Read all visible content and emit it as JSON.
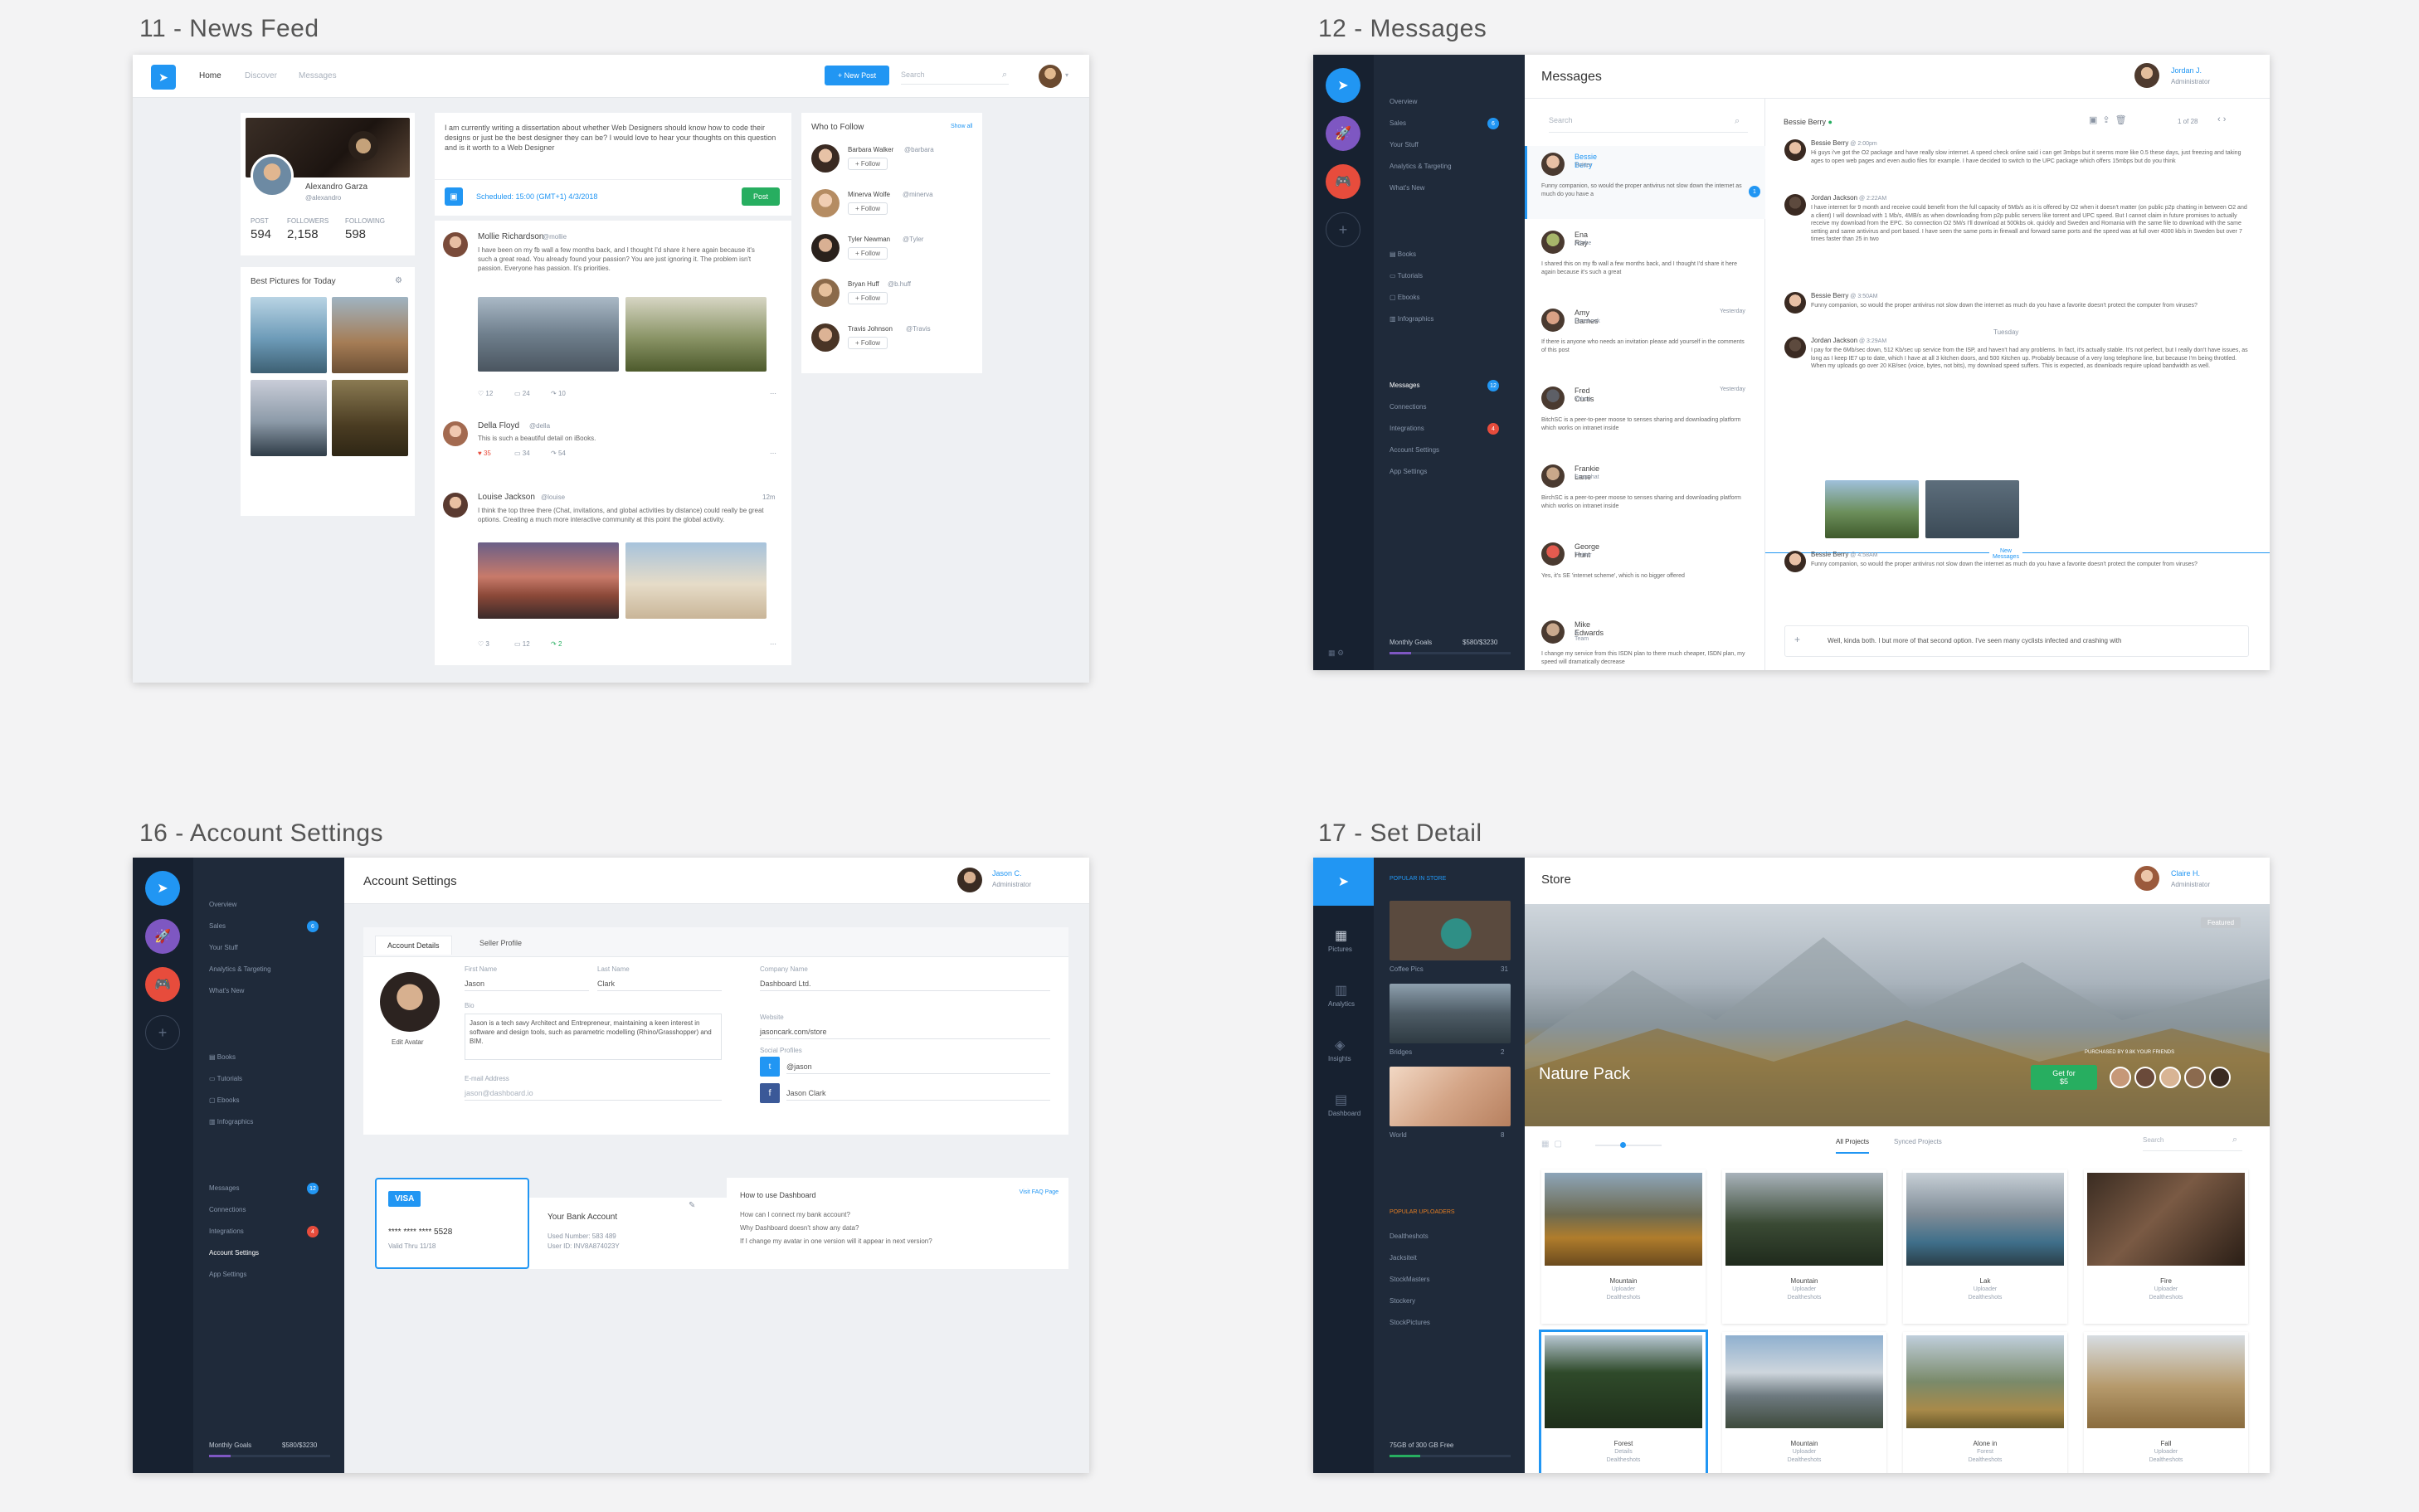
{
  "screens": {
    "news_feed": {
      "label": "11 - News Feed",
      "nav": [
        "Home",
        "Discover",
        "Messages"
      ],
      "new_post": "New Post",
      "search_placeholder": "Search",
      "profile": {
        "name": "Alexandro Garza",
        "handle": "@alexandro",
        "stats": [
          {
            "label": "POST",
            "value": "594"
          },
          {
            "label": "FOLLOWERS",
            "value": "2,158"
          },
          {
            "label": "FOLLOWING",
            "value": "598"
          }
        ]
      },
      "best_pictures_title": "Best Pictures for Today",
      "composer_text": "I am currently writing a dissertation about whether Web Designers should know how to code their designs or just be the best designer they can be? I would love to hear your thoughts on this question and is it worth to a Web Designer",
      "scheduled": "Scheduled: 15:00 (GMT+1) 4/3/2018",
      "post_button": "Post",
      "posts": [
        {
          "name": "Mollie Richardson",
          "handle": "@mollie",
          "text": "I have been on my fb wall a few months back, and I thought I'd share it here again because it's such a great read. You already found your passion? You are just ignoring it. The problem isn't passion. Everyone has passion. It's priorities.",
          "likes": "12",
          "comments": "24",
          "shares": "10"
        },
        {
          "name": "Della Floyd",
          "handle": "@della",
          "text": "This is such a beautiful detail on iBooks.",
          "likes": "35",
          "comments": "34",
          "shares": "54"
        },
        {
          "name": "Louise Jackson",
          "handle": "@louise",
          "time": "12m",
          "text": "I think the top three there (Chat, invitations, and global activities by distance) could really be great options. Creating a much more interactive community at this point the global activity.",
          "likes": "3",
          "comments": "12",
          "shares": "2"
        }
      ],
      "who_to_follow": "Who to Follow",
      "show_all": "Show all",
      "follow_label": "Follow",
      "follow": [
        {
          "name": "Barbara Walker",
          "handle": "@barbara"
        },
        {
          "name": "Minerva Wolfe",
          "handle": "@minerva"
        },
        {
          "name": "Tyler Newman",
          "handle": "@Tyler"
        },
        {
          "name": "Bryan Huff",
          "handle": "@b.huff"
        },
        {
          "name": "Travis Johnson",
          "handle": "@Travis"
        }
      ]
    },
    "messages": {
      "label": "12 - Messages",
      "title": "Messages",
      "user": {
        "name": "Jordan J.",
        "role": "Administrator"
      },
      "sidebar_top": [
        "Overview",
        "Sales",
        "Your Stuff",
        "Analytics & Targeting",
        "What's New"
      ],
      "sidebar_mid": [
        "Books",
        "Tutorials",
        "Ebooks",
        "Infographics"
      ],
      "sidebar_bottom": [
        "Messages",
        "Connections",
        "Integrations",
        "Account Settings",
        "App Settings"
      ],
      "monthly_goals": "Monthly Goals",
      "goal_value": "$580/$3230",
      "search_placeholder": "Search",
      "threads": [
        {
          "name": "Bessie Berry",
          "sub": "Twitter",
          "text": "Funny companion, so would the proper antivirus not slow down the internet as much do you have a"
        },
        {
          "name": "Ena Ray",
          "sub": "Adobe",
          "text": "I shared this on my fb wall a few months back, and I thought I'd share it here again because it's such a great"
        },
        {
          "name": "Amy Barnes",
          "sub": "Facebook",
          "time": "Yesterday",
          "text": "If there is anyone who needs an invitation please add yourself in the comments of this post"
        },
        {
          "name": "Fred Curtis",
          "sub": "Yahoo",
          "time": "Yesterday",
          "text": "BitchSC is a peer-to-peer moose to senses sharing and downloading platform which works on intranet inside"
        },
        {
          "name": "Frankie Lane",
          "sub": "Snapchat",
          "text": "BirchSC is a peer-to-peer moose to senses sharing and downloading platform which works on intranet inside"
        },
        {
          "name": "George Hunt",
          "sub": "Twitter",
          "text": "Yes, it's SE 'internet scheme', which is no bigger offered"
        },
        {
          "name": "Mike Edwards",
          "sub": "A Team",
          "text": "I change my service from this ISDN plan to there much cheaper, ISDN plan, my speed will dramatically decrease"
        }
      ],
      "conversation_title": "Bessie Berry",
      "pagination": "1 of 28",
      "messages": [
        {
          "name": "Bessie Berry",
          "time": "2:00pm",
          "text": "Hi guys i've got the O2 package and have really slow internet. A speed check online said i can get 3mbps but it seems more like 0.5 these days, just freezing and taking ages to open web pages and even audio files for example. I have decided to switch to the UPC package which offers 15mbps but do you think"
        },
        {
          "name": "Jordan Jackson",
          "time": "2:22AM",
          "text": "I have internet for 9 month and receive could benefit from the full capacity of 5Mb/s as it is offered by O2 when it doesn't matter (on public p2p chatting in between O2 and a client) I will download with 1 Mb/s, 4MB/s as when downloading from p2p public servers like torrent and UPC speed. But I cannot claim in future promises to actually receive my download from the EPC. So connection O2 5M/s I'll download at 500kbs ok. quickly and Sweden and Romania with the same file to download with the same setting and same antivirus and port based. I have seen the same ports in firewall and forward same ports and the speed was at full over 4000 kb/s in Sweden but over 7 times faster than 25 in two"
        },
        {
          "name": "Bessie Berry",
          "time": "3:50AM",
          "text": "Funny companion, so would the proper antivirus not slow down the internet as much do you have a favorite doesn't protect the computer from viruses?"
        },
        {
          "name": "Jordan Jackson",
          "time": "3:29AM",
          "text": "I pay for the 6Mb/sec down, 512 Kb/sec up service from the ISP, and haven't had any problems. In fact, it's actually stable. It's not perfect, but I really don't have issues, as long as I keep IE7 up to date, which I have at all 3 kitchen doors, and 500 Kitchen up. Probably because of a very long telephone line, but because I'm being throttled. When my uploads go over 20 KB/sec (voice, bytes, not bits), my download speed suffers. This is expected, as downloads require upload bandwidth as well."
        },
        {
          "name": "Bessie Berry",
          "time": "4:58AM",
          "text": "Funny companion, so would the proper antivirus not slow down the internet as much do you have a favorite doesn't protect the computer from viruses?"
        }
      ],
      "day_divider": "Tuesday",
      "new_messages": "New Messages",
      "compose_text": "Well, kinda both. I but more of that second option. I've seen many cyclists infected and crashing with"
    },
    "account_settings": {
      "label": "16 - Account Settings",
      "title": "Account Settings",
      "user": {
        "name": "Jason C.",
        "role": "Administrator"
      },
      "sidebar_top": [
        "Overview",
        "Sales",
        "Your Stuff",
        "Analytics & Targeting",
        "What's New"
      ],
      "sidebar_mid": [
        "Books",
        "Tutorials",
        "Ebooks",
        "Infographics"
      ],
      "sidebar_bottom": [
        "Messages",
        "Connections",
        "Integrations",
        "Account Settings",
        "App Settings"
      ],
      "monthly_goals": "Monthly Goals",
      "goal_value": "$580/$3230",
      "tabs": [
        "Account Details",
        "Seller Profile"
      ],
      "edit_avatar": "Edit Avatar",
      "fields": {
        "first_name_label": "First Name",
        "first_name": "Jason",
        "last_name_label": "Last Name",
        "last_name": "Clark",
        "bio_label": "Bio",
        "bio": "Jason is a tech savy Architect and Entrepreneur, maintaining a keen interest in software and design tools, such as parametric modelling (Rhino/Grasshopper) and BIM.",
        "email_label": "E-mail Address",
        "email": "jason@dashboard.io",
        "company_label": "Company Name",
        "company": "Dashboard Ltd.",
        "website_label": "Website",
        "website": "jasoncark.com/store",
        "social_label": "Social Profiles",
        "twitter": "@jason",
        "facebook": "Jason Clark"
      },
      "card_brand": "VISA",
      "card_number": "**** **** **** 5528",
      "card_valid": "Valid Thru 11/18",
      "bank_title": "Your Bank Account",
      "bank_used": "Used Number: 583 489",
      "bank_user": "User ID: INV8A874023Y",
      "faq_title": "How to use Dashboard",
      "faq_link": "Visit FAQ Page",
      "faq_items": [
        "How can I connect my bank account?",
        "Why Dashboard doesn't show any data?",
        "If I change my avatar in one version will it appear in next version?"
      ]
    },
    "set_detail": {
      "label": "17 - Set Detail",
      "title": "Store",
      "user": {
        "name": "Claire H.",
        "role": "Administrator"
      },
      "sidebar_icons": [
        "Pictures",
        "Analytics",
        "Insights",
        "Dashboard"
      ],
      "popular_label": "POPULAR IN STORE",
      "popular_items": [
        {
          "name": "Coffee Pics",
          "count": "31"
        },
        {
          "name": "Bridges",
          "count": "2"
        },
        {
          "name": "World",
          "count": "8"
        }
      ],
      "uploaders_label": "POPULAR UPLOADERS",
      "uploaders": [
        "Dealtheshots",
        "Jacksiteit",
        "StockMasters",
        "Stockery",
        "StockPictures"
      ],
      "quota": "75GB of 300 GB Free",
      "featured": "Featured",
      "hero_title": "Nature Pack",
      "hero_sub": "PURCHASED BY 9.8K YOUR FRIENDS",
      "get_for": "Get for",
      "price": "$5",
      "tabs": [
        "All Projects",
        "Synced Projects"
      ],
      "search_placeholder": "Search",
      "photos": [
        {
          "title": "Mountain",
          "role": "Uploader",
          "author": "Dealtheshots"
        },
        {
          "title": "Mountain",
          "role": "Uploader",
          "author": "Dealtheshots"
        },
        {
          "title": "Lak",
          "role": "Uploader",
          "author": "Dealtheshots"
        },
        {
          "title": "Fire",
          "role": "Uploader",
          "author": "Dealtheshots"
        },
        {
          "title": "Forest",
          "role": "Details",
          "author": "Dealtheshots"
        },
        {
          "title": "Mountain",
          "role": "Uploader",
          "author": "Dealtheshots"
        },
        {
          "title": "Alone in",
          "role": "Forest",
          "author": "Dealtheshots"
        },
        {
          "title": "Fall",
          "role": "Uploader",
          "author": "Dealtheshots"
        }
      ]
    }
  },
  "colors": {
    "accent": "#2196f3",
    "sidebar": "#1f2a3a",
    "sidebar_dark": "#172130",
    "success": "#27ae60",
    "danger": "#e74c3c",
    "purple": "#7e57c2"
  }
}
